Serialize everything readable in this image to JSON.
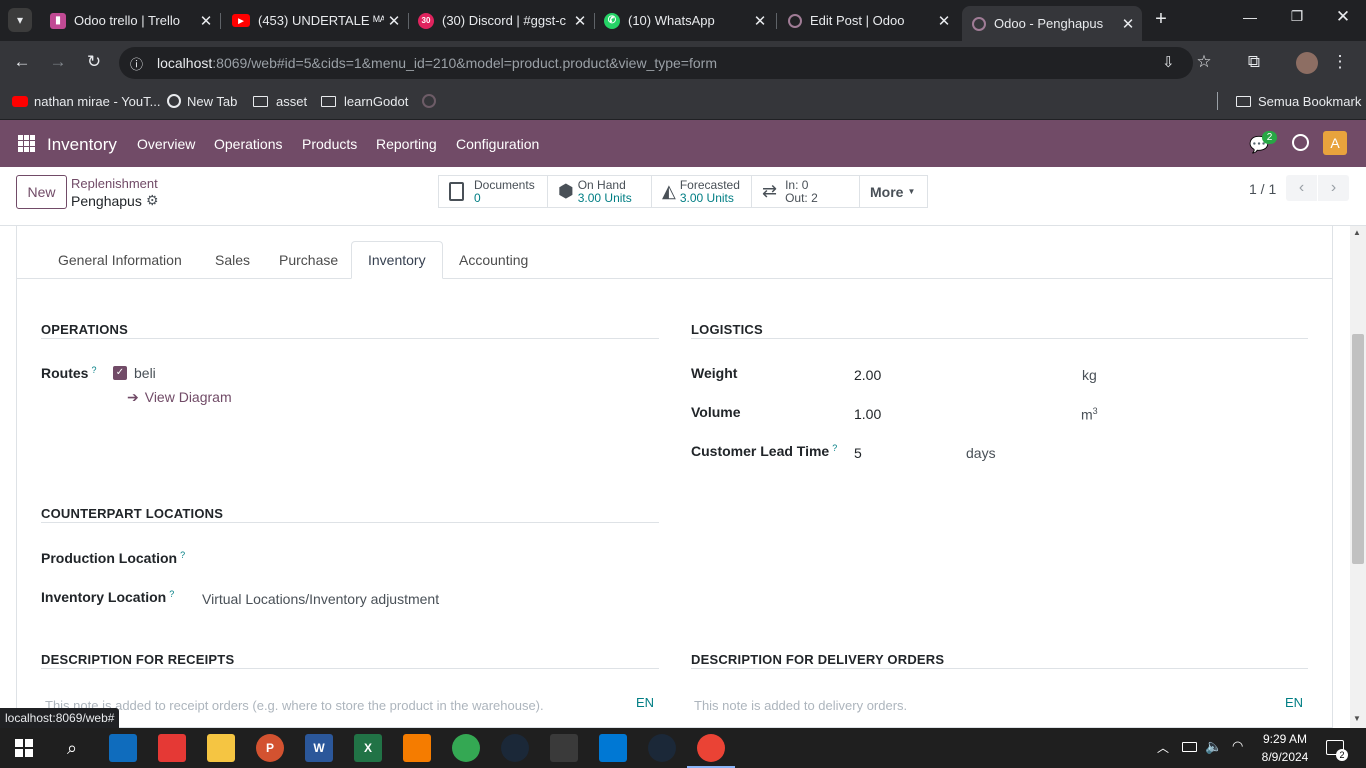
{
  "browser": {
    "tabs": [
      {
        "title": "Odoo trello | Trello",
        "icon": "trello-icon",
        "color": "#c14a94"
      },
      {
        "title": "(453) UNDERTALE ᴹᴬᴵᴺ",
        "icon": "youtube-icon",
        "color": "#ff0000"
      },
      {
        "title": "(30) Discord | #ggst-c",
        "icon": "discord-icon",
        "color": "#e0245e"
      },
      {
        "title": "(10) WhatsApp",
        "icon": "whatsapp-icon",
        "color": "#25d366"
      },
      {
        "title": "Edit Post | Odoo",
        "icon": "odoo-icon",
        "color": "#714b67"
      },
      {
        "title": "Odoo - Penghapus",
        "icon": "odoo-icon",
        "color": "#714b67"
      }
    ],
    "discord_badge": "30",
    "url_host": "localhost",
    "url_rest": ":8069/web#id=5&cids=1&menu_id=210&model=product.product&view_type=form",
    "bookmarks": [
      {
        "label": "nathan mirae - YouT...",
        "icon": "youtube-icon"
      },
      {
        "label": "New Tab",
        "icon": "chrome-icon"
      },
      {
        "label": "asset",
        "icon": "folder-icon"
      },
      {
        "label": "learnGodot",
        "icon": "folder-icon"
      }
    ],
    "all_bookmarks": "Semua Bookmark",
    "status_url": "localhost:8069/web#"
  },
  "navbar": {
    "app": "Inventory",
    "menus": [
      "Overview",
      "Operations",
      "Products",
      "Reporting",
      "Configuration"
    ],
    "chat_count": "2",
    "avatar": "A"
  },
  "control": {
    "new": "New",
    "breadcrumb_parent": "Replenishment",
    "record": "Penghapus",
    "smart": {
      "documents_label": "Documents",
      "documents_value": "0",
      "onhand_label": "On Hand",
      "onhand_value": "3.00 Units",
      "forecast_label": "Forecasted",
      "forecast_value": "3.00 Units",
      "in_label": "In: 0",
      "out_label": "Out: 2",
      "more": "More"
    },
    "pager": "1 / 1"
  },
  "tabs": [
    "General Information",
    "Sales",
    "Purchase",
    "Inventory",
    "Accounting"
  ],
  "operations": {
    "title": "OPERATIONS",
    "routes_label": "Routes",
    "route": "beli",
    "view_diagram": "View Diagram"
  },
  "logistics": {
    "title": "LOGISTICS",
    "weight_label": "Weight",
    "weight": "2.00",
    "weight_unit": "kg",
    "volume_label": "Volume",
    "volume": "1.00",
    "volume_unit": "m",
    "volume_exp": "3",
    "lead_label": "Customer Lead Time",
    "lead": "5",
    "lead_unit": "days"
  },
  "counterpart": {
    "title": "COUNTERPART LOCATIONS",
    "production_label": "Production Location",
    "inventory_label": "Inventory Location",
    "inventory_value": "Virtual Locations/Inventory adjustment"
  },
  "receipts": {
    "title": "DESCRIPTION FOR RECEIPTS",
    "placeholder": "This note is added to receipt orders (e.g. where to store the product in the warehouse).",
    "lang": "EN"
  },
  "delivery": {
    "title": "DESCRIPTION FOR DELIVERY ORDERS",
    "placeholder": "This note is added to delivery orders.",
    "lang": "EN"
  },
  "taskbar": {
    "time": "9:29 AM",
    "date": "8/9/2024",
    "notifications": "2"
  },
  "colors": {
    "primary": "#714b67",
    "teal": "#017e84"
  }
}
